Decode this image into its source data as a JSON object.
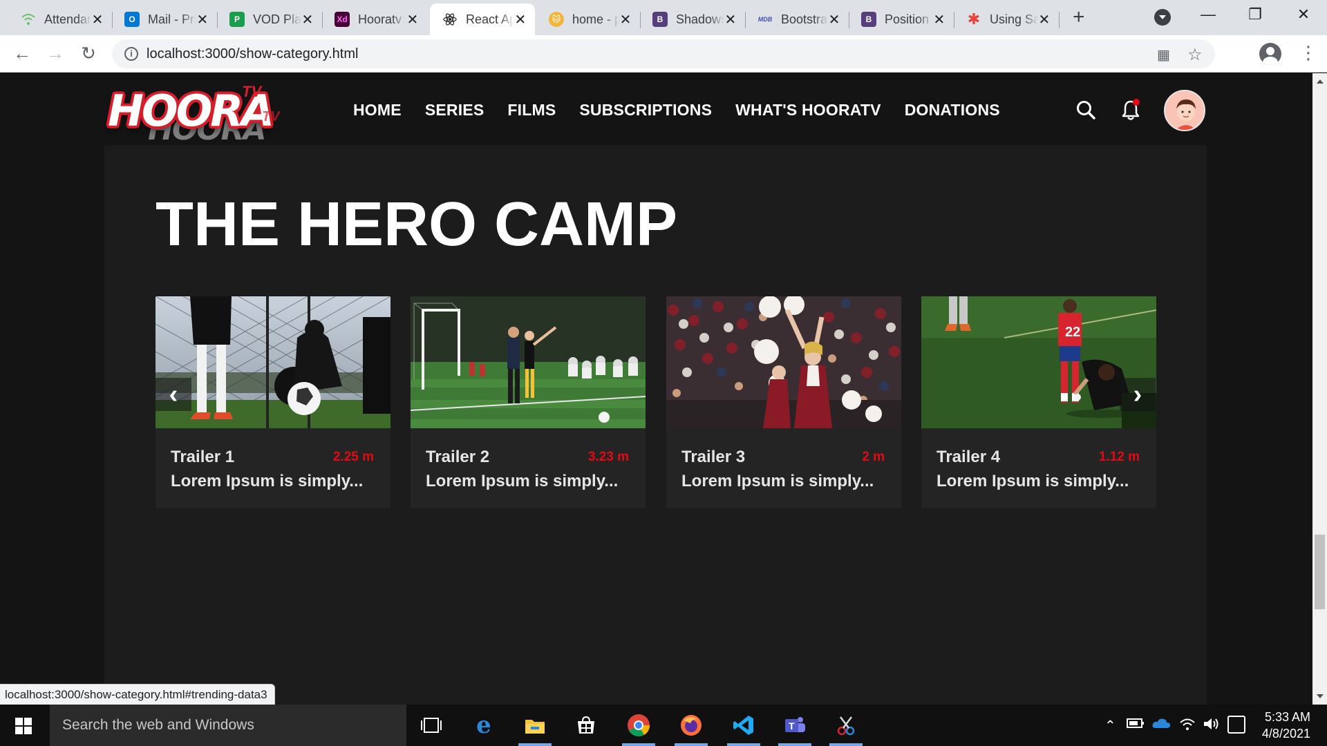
{
  "browser": {
    "tabs": [
      {
        "title": "Attendance",
        "favicon": "wifi-icon",
        "color": "#6abf69"
      },
      {
        "title": "Mail - Priyanka",
        "favicon": "outlook-icon",
        "color": "#0078d4",
        "letter": "O"
      },
      {
        "title": "VOD Platform",
        "favicon": "planner-icon",
        "color": "#1b9e4b",
        "letter": "P"
      },
      {
        "title": "Hooratv",
        "favicon": "xd-icon",
        "color": "#470137",
        "letter": "Xd"
      },
      {
        "title": "React App",
        "favicon": "react-icon",
        "color": "#61dafb",
        "active": true
      },
      {
        "title": "home - page",
        "favicon": "cat-icon",
        "color": "#f3b63a"
      },
      {
        "title": "Shadows",
        "favicon": "bootstrap-icon",
        "color": "#563d7c",
        "letter": "B"
      },
      {
        "title": "Bootstrap",
        "favicon": "mdb-icon",
        "color": "#3f51b5",
        "letter": "MDB"
      },
      {
        "title": "Position",
        "favicon": "bootstrap-icon",
        "color": "#563d7c",
        "letter": "B"
      },
      {
        "title": "Using Sass",
        "favicon": "asterisk-icon",
        "color": "#e6433a",
        "letter": "✱"
      }
    ],
    "url": "localhost:3000/show-category.html",
    "status_url": "localhost:3000/show-category.html#trending-data3"
  },
  "site": {
    "logo_text": "HOORA",
    "logo_shadow": "HOORA",
    "logo_sup": "TV",
    "logo_sup2": "TV",
    "nav": [
      "HOME",
      "SERIES",
      "FILMS",
      "SUBSCRIPTIONS",
      "WHAT'S HOORATV",
      "DONATIONS"
    ],
    "accent": "#e50914"
  },
  "page": {
    "title": "THE HERO CAMP",
    "cards": [
      {
        "name": "Trailer 1",
        "duration": "2.25 m",
        "desc": "Lorem Ipsum is simply...",
        "scene": "soccer-ball-fence"
      },
      {
        "name": "Trailer 2",
        "duration": "3.23 m",
        "desc": "Lorem Ipsum is simply...",
        "scene": "soccer-field-goal"
      },
      {
        "name": "Trailer 3",
        "duration": "2 m",
        "desc": "Lorem Ipsum is simply...",
        "scene": "cheerleader-crowd"
      },
      {
        "name": "Trailer 4",
        "duration": "1.12 m",
        "desc": "Lorem Ipsum is simply...",
        "scene": "injured-player"
      }
    ],
    "prev_label": "‹",
    "next_label": "›"
  },
  "taskbar": {
    "search_placeholder": "Search the web and Windows",
    "time": "5:33 AM",
    "date": "4/8/2021"
  }
}
